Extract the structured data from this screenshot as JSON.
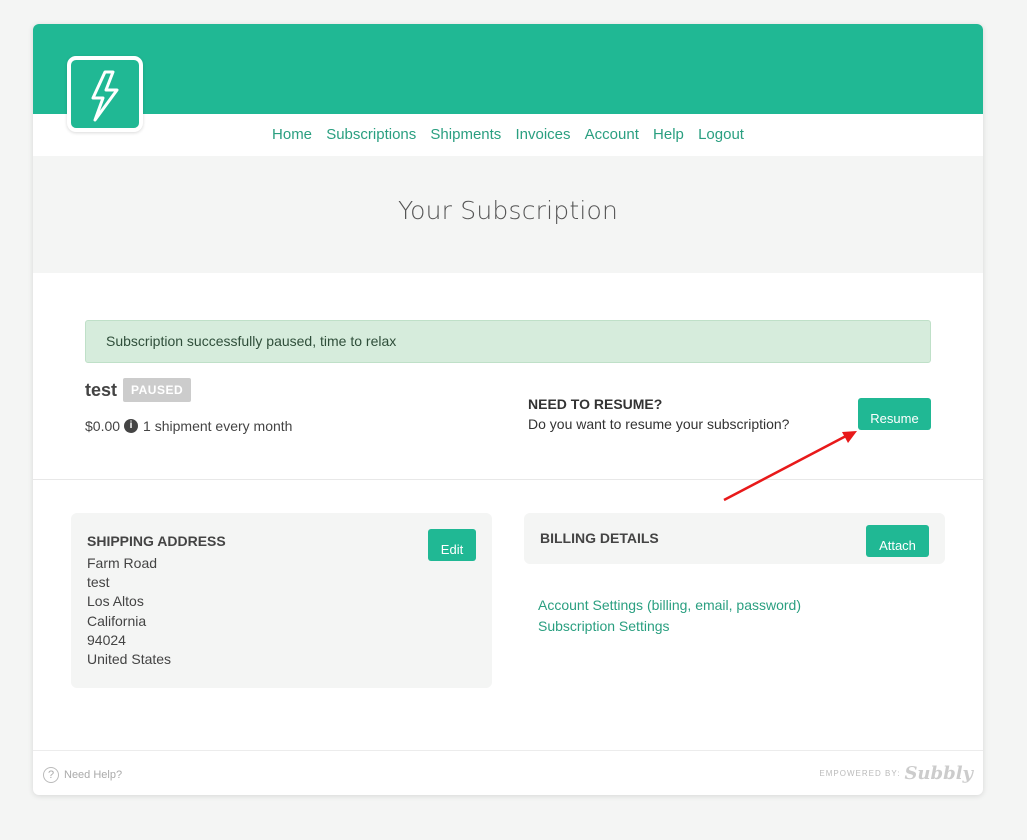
{
  "nav": {
    "items": [
      "Home",
      "Subscriptions",
      "Shipments",
      "Invoices",
      "Account",
      "Help",
      "Logout"
    ]
  },
  "page_title": "Your Subscription",
  "alert": "Subscription successfully paused, time to relax",
  "subscription": {
    "name": "test",
    "status": "PAUSED",
    "price": "$0.00",
    "frequency": "1 shipment every month"
  },
  "resume": {
    "title": "NEED TO RESUME?",
    "question": "Do you want to resume your subscription?",
    "button": "Resume"
  },
  "shipping": {
    "title": "SHIPPING ADDRESS",
    "edit_label": "Edit",
    "lines": [
      "Farm Road",
      "test",
      "Los Altos",
      "California",
      "94024",
      "United States"
    ]
  },
  "billing": {
    "title": "BILLING DETAILS",
    "attach_label": "Attach",
    "links": [
      "Account Settings (billing, email, password)",
      "Subscription Settings"
    ]
  },
  "footer": {
    "help": "Need Help?",
    "powered_by": "EMPOWERED BY:",
    "brand": "Subbly"
  },
  "colors": {
    "brand_green": "#20b894",
    "link_green": "#2a9f80",
    "alert_bg": "#d6ecdc",
    "badge_gray": "#cccccc",
    "annotation_arrow": "#e8191a"
  },
  "icons": [
    "lightning-bolt-icon",
    "info-icon",
    "question-circle-icon",
    "red-arrow-annotation"
  ]
}
